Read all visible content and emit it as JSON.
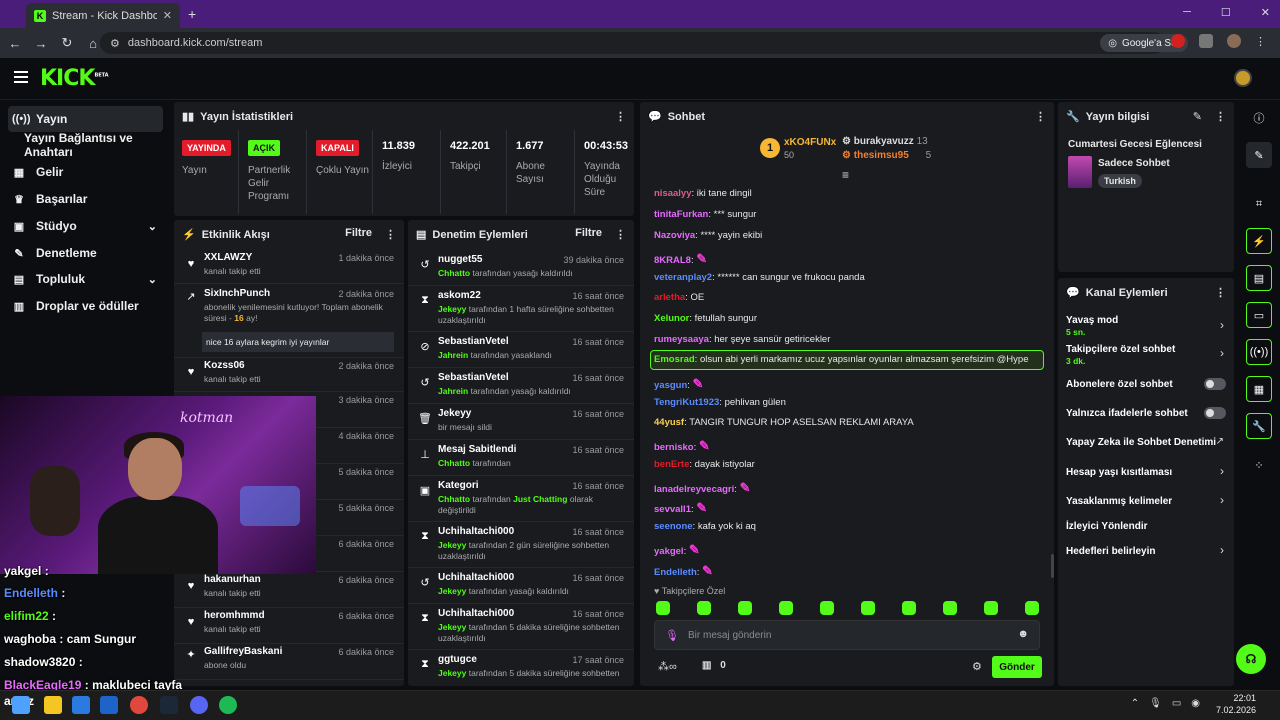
{
  "browser": {
    "tab_title": "Stream - Kick Dashboard",
    "url": "dashboard.kick.com/stream",
    "ask_google": "Google'a Sor"
  },
  "header": {
    "logo": "KICK",
    "logo_tag": "BETA"
  },
  "leftnav": [
    {
      "label": "Yayın",
      "icon": "stream-icon",
      "active": true
    },
    {
      "label": "Yayın Bağlantısı ve Anahtarı",
      "icon": "",
      "active": false
    },
    {
      "label": "Gelir",
      "icon": "chart-icon"
    },
    {
      "label": "Başarılar",
      "icon": "trophy-icon"
    },
    {
      "label": "Stüdyo",
      "icon": "studio-icon",
      "chevron": true
    },
    {
      "label": "Denetleme",
      "icon": "wrench-icon"
    },
    {
      "label": "Topluluk",
      "icon": "community-icon",
      "chevron": true
    },
    {
      "label": "Droplar ve ödüller",
      "icon": "gift-icon"
    }
  ],
  "stats": {
    "title": "Yayın İstatistikleri",
    "items": [
      {
        "badge": "YAYINDA",
        "label": "Yayın",
        "badge_color": "#e31b2a"
      },
      {
        "badge": "AÇIK",
        "label": "Partnerlik Gelir Programı",
        "badge_color": "#53fc18"
      },
      {
        "badge": "KAPALI",
        "label": "Çoklu Yayın",
        "badge_color": "#e31b2a"
      },
      {
        "num": "11.839",
        "label": "İzleyici"
      },
      {
        "num": "422.201",
        "label": "Takipçi"
      },
      {
        "num": "1.677",
        "label": "Abone Sayısı"
      },
      {
        "num": "00:43:53",
        "label": "Yayında Olduğu Süre"
      }
    ]
  },
  "activity": {
    "title": "Etkinlik Akışı",
    "filter": "Filtre",
    "items": [
      {
        "name": "XXLAWZY",
        "sub": "kanalı takip etti",
        "time": "1 dakika önce"
      },
      {
        "name": "SixInchPunch",
        "sub": "abonelik yenilemesini kutluyor! Toplam abonelik süresi -",
        "sub_hl": "16",
        "sub_end": "ay!",
        "time": "2 dakika önce",
        "quote": "nice 16 aylara kegrim iyi yayınlar"
      },
      {
        "name": "Kozss06",
        "sub": "kanalı takip etti",
        "time": "2 dakika önce"
      },
      {
        "name": "",
        "sub": "",
        "time": "3 dakika önce"
      },
      {
        "name": "",
        "sub": "",
        "time": "4 dakika önce"
      },
      {
        "name": "",
        "sub": "",
        "time": "5 dakika önce"
      },
      {
        "name": "",
        "sub": "",
        "time": "5 dakika önce"
      },
      {
        "name": "",
        "sub": "",
        "time": "6 dakika önce"
      },
      {
        "name": "hakanurhan",
        "sub": "kanalı takip etti",
        "time": "6 dakika önce"
      },
      {
        "name": "heromhmmd",
        "sub": "kanalı takip etti",
        "time": "6 dakika önce"
      },
      {
        "name": "GallifreyBaskani",
        "sub": "abone oldu",
        "time": "6 dakika önce"
      }
    ]
  },
  "moderation": {
    "title": "Denetim Eylemleri",
    "filter": "Filtre",
    "items": [
      {
        "name": "nugget55",
        "actor": "Chhatto",
        "sub": "tarafından yasağı kaldırıldı",
        "time": "39 dakika önce"
      },
      {
        "name": "askom22",
        "actor": "Jekeyy",
        "sub": "tarafından 1 hafta süreliğine sohbetten uzaklaştırıldı",
        "time": "16 saat önce"
      },
      {
        "name": "SebastianVetel",
        "actor": "Jahrein",
        "sub": "tarafından yasaklandı",
        "time": "16 saat önce"
      },
      {
        "name": "SebastianVetel",
        "actor": "Jahrein",
        "sub": "tarafından yasağı kaldırıldı",
        "time": "16 saat önce"
      },
      {
        "name": "Jekeyy",
        "actor": "",
        "sub": "bir mesajı sildi",
        "time": "16 saat önce"
      },
      {
        "name": "Mesaj Sabitlendi",
        "actor": "Chhatto",
        "sub": "tarafından",
        "time": "16 saat önce"
      },
      {
        "name": "Kategori",
        "actor": "Chhatto",
        "sub": "tarafından",
        "sub_hl": "Just Chatting",
        "sub_end": "olarak değiştirildi",
        "time": "16 saat önce"
      },
      {
        "name": "Uchihaltachi000",
        "actor": "Jekeyy",
        "sub": "tarafından 2 gün süreliğine sohbetten uzaklaştırıldı",
        "time": "16 saat önce"
      },
      {
        "name": "Uchihaltachi000",
        "actor": "Jekeyy",
        "sub": "tarafından yasağı kaldırıldı",
        "time": "16 saat önce"
      },
      {
        "name": "Uchihaltachi000",
        "actor": "Jekeyy",
        "sub": "tarafından 5 dakika süreliğine sohbetten uzaklaştırıldı",
        "time": "16 saat önce"
      },
      {
        "name": "ggtugce",
        "actor": "Jekeyy",
        "sub": "tarafından 5 dakika süreliğine sohbetten",
        "time": "17 saat önce"
      }
    ]
  },
  "chat": {
    "title": "Sohbet",
    "leaders": [
      {
        "rank": "1",
        "name": "xKO4FUNx",
        "count": "50"
      },
      {
        "name": "burakyavuzz",
        "count": "13"
      },
      {
        "name": "thesimsu95",
        "count": "5"
      }
    ],
    "messages": [
      {
        "user": "nisaalyy",
        "color": "#e05c8a",
        "text": "iki tane dingil"
      },
      {
        "user": "tinitaFurkan",
        "color": "#e76bff",
        "text": "*** sungur"
      },
      {
        "user": "Nazoviya",
        "color": "#e76bff",
        "text": "**** yayin ekibi"
      },
      {
        "user": "8KRAL8",
        "color": "#e76bff",
        "text": ""
      },
      {
        "user": "veteranplay2",
        "color": "#5b8cff",
        "text": "****** can sungur ve frukocu panda"
      },
      {
        "user": "arletha",
        "color": "#e31b2a",
        "text": "OE"
      },
      {
        "user": "Xelunor",
        "color": "#53fc18",
        "text": "fetullah sungur"
      },
      {
        "user": "rumeysaaya",
        "color": "#e76bff",
        "text": "her şeye sansür getiricekler"
      },
      {
        "user": "Emosrad",
        "color": "#53fc18",
        "text": "olsun abi yerli markamız ucuz yapsınlar oyunları almazsam şerefsizim @Hype"
      },
      {
        "user": "yasgun",
        "color": "#5b8cff",
        "text": ""
      },
      {
        "user": "TengriKut1923",
        "color": "#5b8cff",
        "text": "pehlivan gülen"
      },
      {
        "user": "44yusf",
        "color": "#f7d154",
        "text": "TANGIR TUNGUR HOP ASELSAN REKLAMI ARAYA"
      },
      {
        "user": "bernisko",
        "color": "#e76bff",
        "text": ""
      },
      {
        "user": "benErte",
        "color": "#e31b2a",
        "text": "dayak istiyolar"
      },
      {
        "user": "lanadelreyvecagri",
        "color": "#e76bff",
        "text": ""
      },
      {
        "user": "sevvall1",
        "color": "#e76bff",
        "text": ""
      },
      {
        "user": "seenone",
        "color": "#5b8cff",
        "text": "kafa yok ki aq"
      },
      {
        "user": "yakgel",
        "color": "#e76bff",
        "text": ""
      },
      {
        "user": "Endelleth",
        "color": "#5b8cff",
        "text": ""
      }
    ],
    "followers_only": "Takipçilere Özel",
    "input_placeholder": "Bir mesaj gönderin",
    "points": "0",
    "send": "Gönder"
  },
  "stream_info": {
    "title": "Yayın bilgisi",
    "stream_title": "Cumartesi Gecesi Eğlencesi",
    "category": "Sadece Sohbet",
    "language": "Turkish"
  },
  "channel_actions": {
    "title": "Kanal Eylemleri",
    "items": [
      {
        "label": "Yavaş mod",
        "sub": "5 sn.",
        "control": "chevron"
      },
      {
        "label": "Takipçilere özel sohbet",
        "sub": "3 dk.",
        "control": "chevron"
      },
      {
        "label": "Abonelere özel sohbet",
        "control": "toggle"
      },
      {
        "label": "Yalnızca ifadelerle sohbet",
        "control": "toggle"
      },
      {
        "label": "Yapay Zeka ile Sohbet Denetimi",
        "control": "external"
      },
      {
        "label": "Hesap yaşı kısıtlaması",
        "control": "chevron"
      },
      {
        "label": "Yasaklanmış kelimeler",
        "control": "chevron"
      },
      {
        "label": "İzleyici Yönlendir",
        "control": "none"
      },
      {
        "label": "Hedefleri belirleyin",
        "control": "chevron"
      }
    ]
  },
  "overlay_chat": [
    {
      "user": "yakgel",
      "text": ":"
    },
    {
      "user": "Endelleth",
      "text": ":"
    },
    {
      "user": "elifim22",
      "text": ":"
    },
    {
      "user": "waghoba",
      "text": ": cam Sungur"
    },
    {
      "user": "shadow3820",
      "text": ":"
    },
    {
      "user": "BlackEagle19",
      "text": ": maklubeci tayfa"
    }
  ],
  "webcam_sign": "kotman",
  "taskbar": {
    "time": "22:01",
    "date": "7.02.2026",
    "left_text": "amaz"
  }
}
